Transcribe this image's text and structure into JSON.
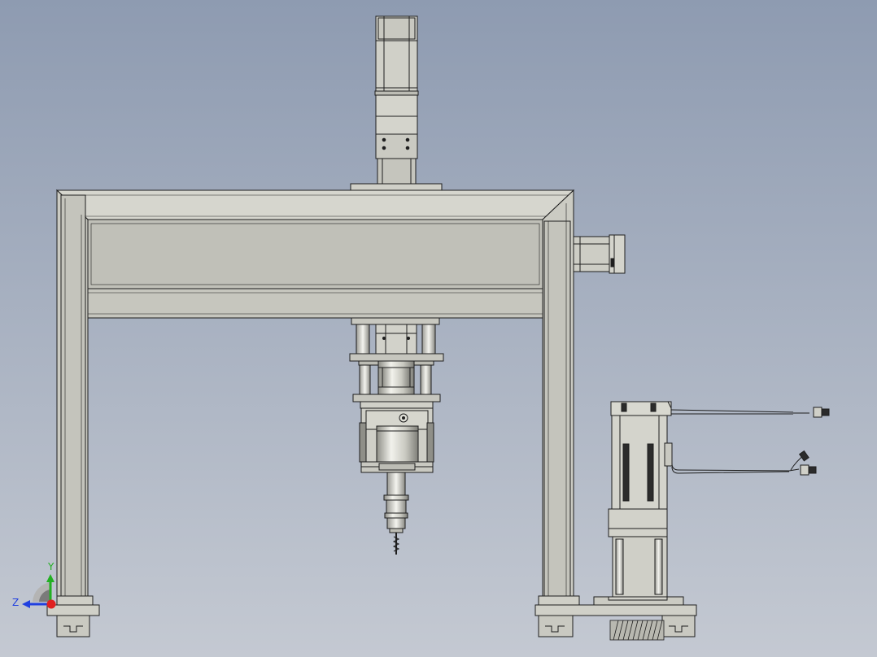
{
  "viewport": {
    "background_top": "#8e9bb1",
    "background_bottom": "#c4c9d2"
  },
  "colors": {
    "frame_fill": "#c2c2ba",
    "frame_light": "#d4d4cc",
    "frame_dark": "#a9a9a1",
    "edge": "#1e1e1e",
    "metal": "#d0d0c8",
    "chrome_light": "#efefe9",
    "chrome_dark": "#8d8d86",
    "motor_dark": "#2b2b2b"
  },
  "triad": {
    "y_label": "Y",
    "z_label": "Z",
    "x_color": "#e02020",
    "y_color": "#22b022",
    "z_color": "#2040e0"
  }
}
